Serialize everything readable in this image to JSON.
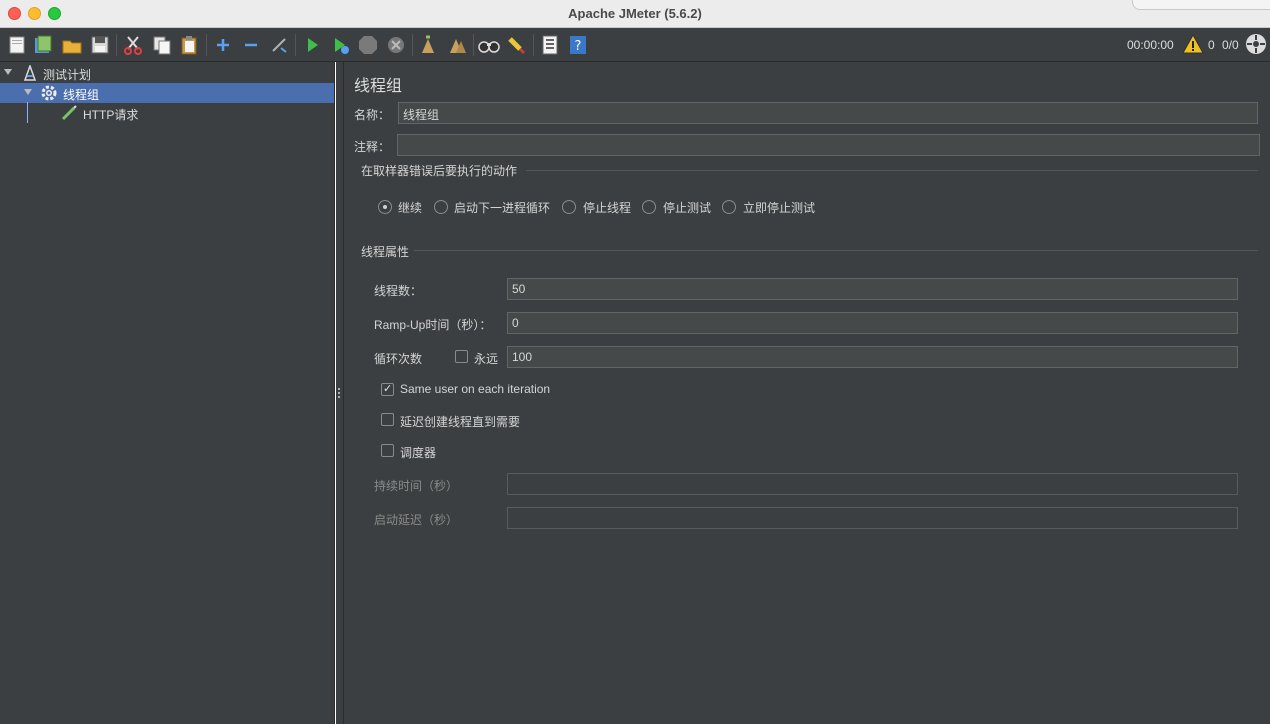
{
  "window": {
    "title": "Apache JMeter (5.6.2)"
  },
  "toolbar": {
    "timer": "00:00:00",
    "warning_count": "0",
    "thread_count": "0/0",
    "icons": [
      "new-icon",
      "templates-icon",
      "open-icon",
      "save-icon",
      "cut-icon",
      "copy-icon",
      "paste-icon",
      "expand-icon",
      "collapse-icon",
      "toggle-icon",
      "start-icon",
      "start-no-pause-icon",
      "stop-icon",
      "shutdown-icon",
      "clear-icon",
      "clear-all-icon",
      "search-icon",
      "reset-search-icon",
      "function-helper-icon",
      "help-icon",
      "warning-icon",
      "remote-icon"
    ]
  },
  "tree": {
    "items": [
      {
        "label": "测试计划",
        "level": 0
      },
      {
        "label": "线程组",
        "level": 1,
        "selected": true
      },
      {
        "label": "HTTP请求",
        "level": 2
      }
    ]
  },
  "panel": {
    "title": "线程组",
    "name_label": "名称：",
    "name_value": "线程组",
    "comment_label": "注释：",
    "comment_value": "",
    "error_section_title": "在取样器错误后要执行的动作",
    "error_actions": [
      {
        "label": "继续",
        "selected": true
      },
      {
        "label": "启动下一进程循环",
        "selected": false
      },
      {
        "label": "停止线程",
        "selected": false
      },
      {
        "label": "停止测试",
        "selected": false
      },
      {
        "label": "立即停止测试",
        "selected": false
      }
    ],
    "props_section_title": "线程属性",
    "threads_label": "线程数：",
    "threads_value": "50",
    "rampup_label": "Ramp-Up时间（秒）：",
    "rampup_value": "0",
    "loop_label": "循环次数",
    "forever_label": "永远",
    "forever_checked": false,
    "loop_value": "100",
    "same_user_label": "Same user on each iteration",
    "same_user_checked": true,
    "delay_create_label": "延迟创建线程直到需要",
    "delay_create_checked": false,
    "scheduler_label": "调度器",
    "scheduler_checked": false,
    "duration_label": "持续时间（秒）",
    "duration_value": "",
    "startup_delay_label": "启动延迟（秒）",
    "startup_delay_value": ""
  },
  "colors": {
    "background": "#3c3f41",
    "selection": "#4b6eaf",
    "field": "#45494a"
  }
}
